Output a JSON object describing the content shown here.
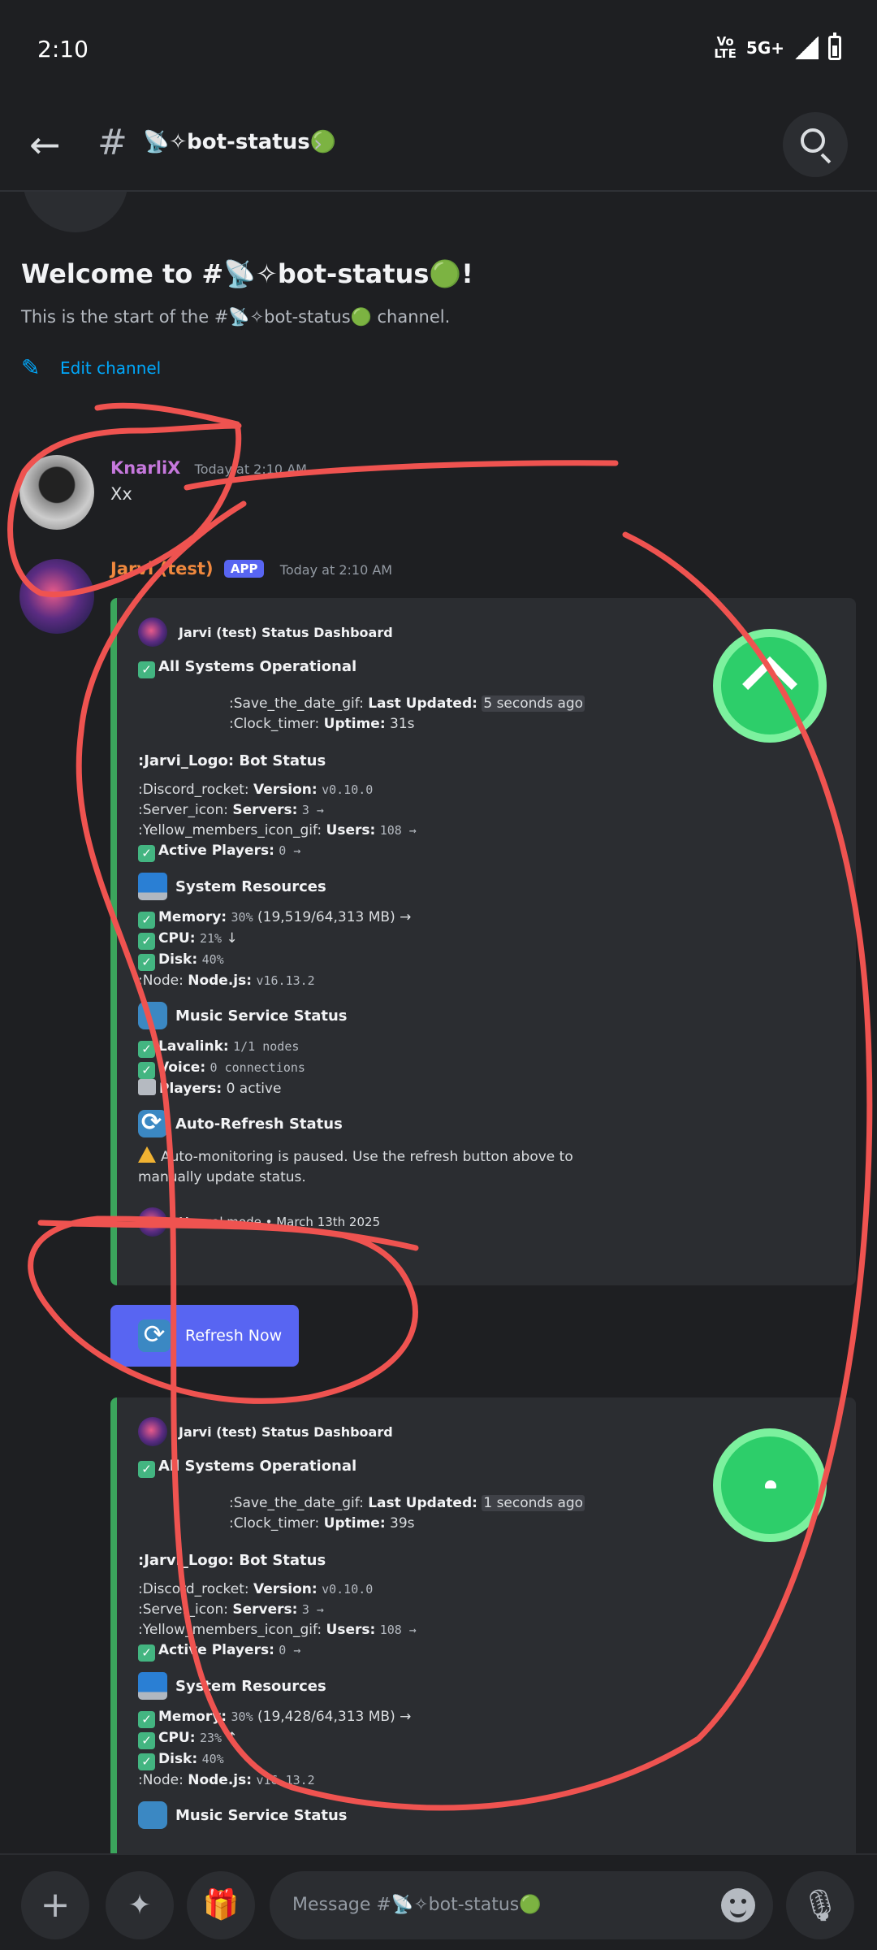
{
  "status_bar": {
    "time": "2:10",
    "volte": "Vo\nLTE",
    "network": "5G+"
  },
  "header": {
    "channel": "📡✧bot-status🟢",
    "chevron": "›"
  },
  "welcome": {
    "title": "Welcome to #📡✧bot-status🟢!",
    "subtitle": "This is the start of the #📡✧bot-status🟢 channel.",
    "edit_label": "Edit channel"
  },
  "messages": [
    {
      "author": "KnarliX",
      "author_color": "#c678dd",
      "timestamp": "Today at 2:10 AM",
      "text": "Xx"
    },
    {
      "author": "Jarvi (test)",
      "author_color": "#f0883e",
      "badge": "APP",
      "timestamp": "Today at 2:10 AM"
    }
  ],
  "embeds": [
    {
      "author": "Jarvi (test) Status Dashboard",
      "status": "All Systems Operational",
      "updated_prefix": ":Save_the_date_gif: ",
      "updated_label": "Last Updated:",
      "updated_value": "5 seconds ago",
      "uptime_prefix": ":Clock_timer: ",
      "uptime_label": "Uptime:",
      "uptime_value": "31s",
      "bot_heading": ":Jarvi_Logo: Bot Status",
      "version_prefix": ":Discord_rocket: ",
      "version_label": "Version:",
      "version_value": "v0.10.0",
      "servers_prefix": ":Server_icon: ",
      "servers_label": "Servers:",
      "servers_value": "3 →",
      "users_prefix": ":Yellow_members_icon_gif: ",
      "users_label": "Users:",
      "users_value": "108 →",
      "players_label": "Active Players:",
      "players_value": "0 →",
      "sys_heading": "System Resources",
      "memory_label": "Memory:",
      "memory_value": "30%",
      "memory_detail": "(19,519/64,313 MB) →",
      "cpu_label": "CPU:",
      "cpu_value": "21%",
      "cpu_trend": "↓",
      "disk_label": "Disk:",
      "disk_value": "40%",
      "node_prefix": ":Node: ",
      "node_label": "Node.js:",
      "node_value": "v16.13.2",
      "music_heading": "Music Service Status",
      "lavalink_label": "Lavalink:",
      "lavalink_value": "1/1 nodes",
      "voice_label": "Voice:",
      "voice_value": "0 connections",
      "mplayers_label": "Players:",
      "mplayers_value": "0 active",
      "auto_heading": "Auto-Refresh Status",
      "auto_text": "Auto-monitoring is paused. Use the refresh button above to manually update status.",
      "footer": "Manual mode • March 13th 2025"
    },
    {
      "author": "Jarvi (test) Status Dashboard",
      "status": "All Systems Operational",
      "updated_prefix": ":Save_the_date_gif: ",
      "updated_label": "Last Updated:",
      "updated_value": "1 seconds ago",
      "uptime_prefix": ":Clock_timer: ",
      "uptime_label": "Uptime:",
      "uptime_value": "39s",
      "bot_heading": ":Jarvi_Logo: Bot Status",
      "version_prefix": ":Discord_rocket: ",
      "version_label": "Version:",
      "version_value": "v0.10.0",
      "servers_prefix": ":Server_icon: ",
      "servers_label": "Servers:",
      "servers_value": "3 →",
      "users_prefix": ":Yellow_members_icon_gif: ",
      "users_label": "Users:",
      "users_value": "108 →",
      "players_label": "Active Players:",
      "players_value": "0 →",
      "sys_heading": "System Resources",
      "memory_label": "Memory:",
      "memory_value": "30%",
      "memory_detail": "(19,428/64,313 MB) →",
      "cpu_label": "CPU:",
      "cpu_value": "23%",
      "cpu_trend": "↑",
      "disk_label": "Disk:",
      "disk_value": "40%",
      "node_prefix": ":Node: ",
      "node_label": "Node.js:",
      "node_value": "v16.13.2",
      "music_heading": "Music Service Status"
    }
  ],
  "refresh_button": {
    "label": "Refresh Now"
  },
  "composer": {
    "placeholder": "Message #📡✧bot-status🟢"
  },
  "colors": {
    "accent": "#5865f2",
    "embed_border": "#3ba55c",
    "link": "#00a8fc",
    "scribble": "#ef5350"
  }
}
